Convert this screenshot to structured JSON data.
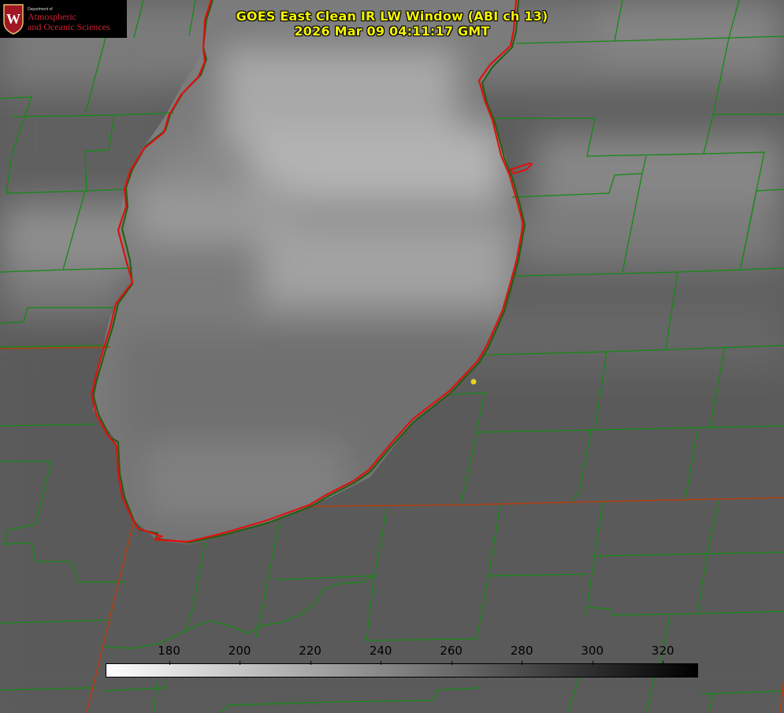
{
  "title": {
    "line1": "GOES East Clean IR LW Window (ABI ch 13)",
    "line2": "2026 Mar 09 04:11:17 GMT"
  },
  "logo": {
    "dept_small": "Department of",
    "line1": "Atmospheric",
    "line2": "and Oceanic Sciences",
    "shield_letter": "W",
    "icon": "uw-crest-icon"
  },
  "colorbar": {
    "ticks": [
      "180",
      "200",
      "220",
      "240",
      "260",
      "280",
      "300",
      "320"
    ],
    "tick_values": [
      180,
      200,
      220,
      240,
      260,
      280,
      300,
      320
    ],
    "range": [
      162,
      330
    ],
    "gradient": "white-to-black"
  },
  "colors": {
    "title": "#f5f500",
    "county_lines": "#138a13",
    "lake_outline": "#e01010",
    "state_line": "#b04010",
    "marker": "#e8d020",
    "logo_text": "#d02030"
  },
  "icons": {
    "marker": "station-dot-icon"
  }
}
